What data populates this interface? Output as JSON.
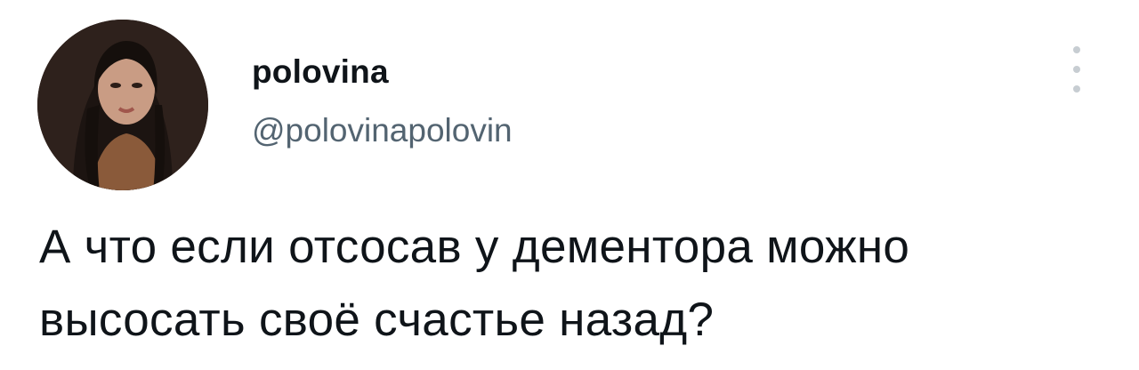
{
  "tweet": {
    "author": {
      "display_name": "polovina",
      "handle": "@polovinapolovin"
    },
    "text_lines": [
      "А что если отсосав у дементора можно",
      "высосать своё счастье назад?"
    ],
    "more_icon": "more-vertical-icon"
  }
}
